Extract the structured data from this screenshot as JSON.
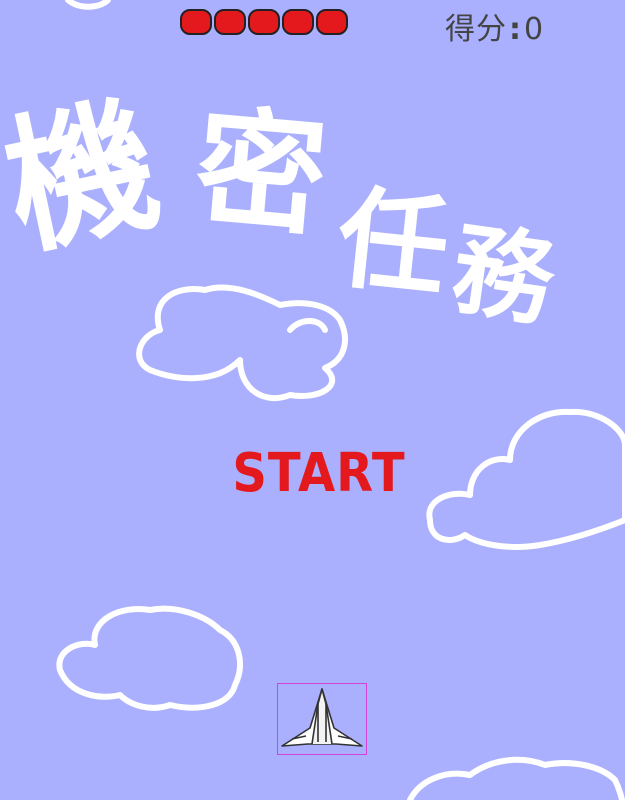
{
  "hud": {
    "lives": [
      1,
      2,
      3,
      4,
      5
    ],
    "score_label": "得分",
    "score_sep": ":",
    "score_value": "0"
  },
  "title": {
    "chars": [
      "機",
      "密",
      "任",
      "務"
    ]
  },
  "start_button": {
    "label": "START"
  },
  "colors": {
    "background": "#aab0fe",
    "life": "#e3191e",
    "start": "#e3191e",
    "cloud": "#ffffff",
    "player_box": "#d042d8"
  },
  "icons": {
    "player": "jet-plane-icon",
    "cloud": "cloud-outline-icon"
  }
}
